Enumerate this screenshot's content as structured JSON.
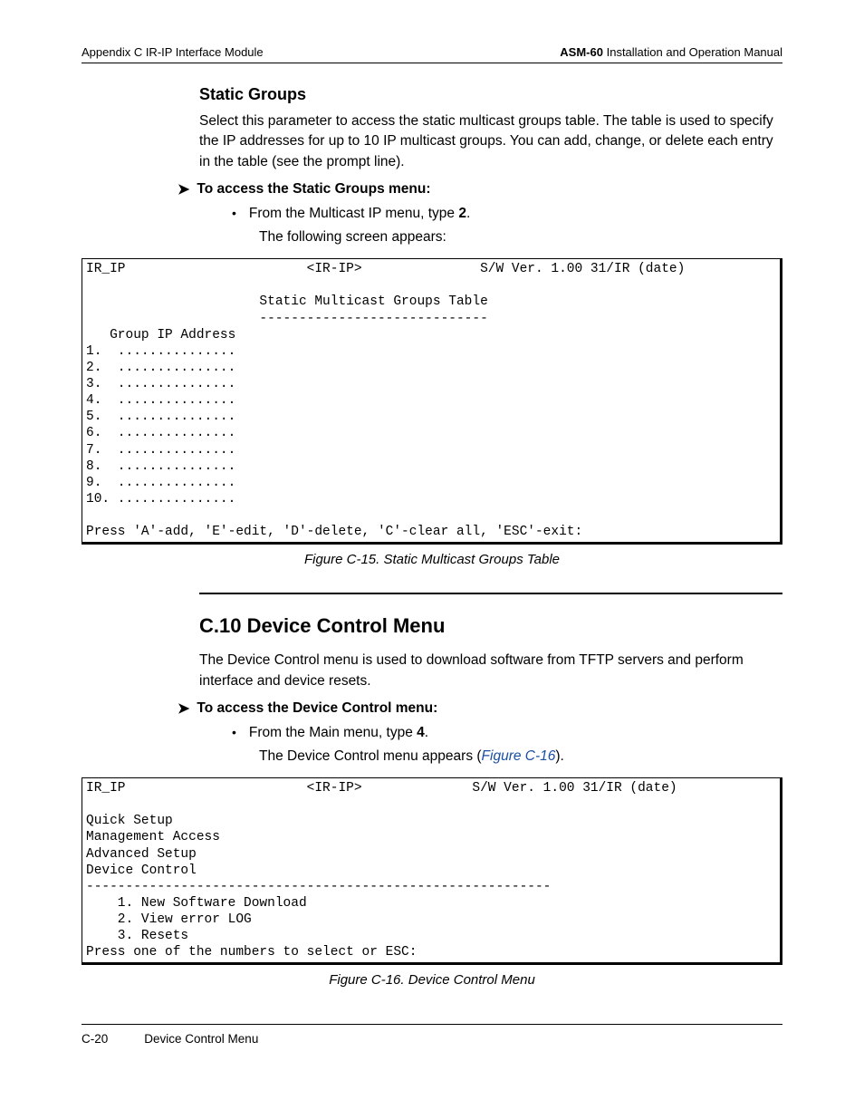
{
  "header": {
    "left": "Appendix C  IR-IP Interface Module",
    "right_bold": "ASM-60",
    "right_rest": " Installation and Operation Manual"
  },
  "sec1": {
    "title": "Static Groups",
    "para": "Select this parameter to access the static multicast groups table. The table is used to specify the IP addresses for up to 10 IP multicast groups. You can add, change, or delete each entry in the table (see the prompt line).",
    "proc": "To access the Static Groups menu:",
    "bullet_pre": "From the Multicast IP menu, type ",
    "bullet_bold": "2",
    "bullet_post": ".",
    "result": "The following screen appears:",
    "caption": "Figure C-15.  Static Multicast Groups Table"
  },
  "terminal1": "IR_IP                       <IR-IP>               S/W Ver. 1.00 31/IR (date)\n\n                      Static Multicast Groups Table\n                      -----------------------------\n   Group IP Address\n1.  ...............\n2.  ...............\n3.  ...............\n4.  ...............\n5.  ...............\n6.  ...............\n7.  ...............\n8.  ...............\n9.  ...............\n10. ...............\n\nPress 'A'-add, 'E'-edit, 'D'-delete, 'C'-clear all, 'ESC'-exit:",
  "sec2": {
    "heading": "C.10    Device Control Menu",
    "para": "The Device Control menu is used to download software from TFTP servers and perform interface and device resets.",
    "proc": "To access the Device Control menu:",
    "bullet_pre": "From the Main menu, type ",
    "bullet_bold": "4",
    "bullet_post": ".",
    "result_pre": "The Device Control menu appears (",
    "result_link": "Figure C-16",
    "result_post": ").",
    "caption": "Figure C-16.  Device Control Menu"
  },
  "terminal2": "IR_IP                       <IR-IP>              S/W Ver. 1.00 31/IR (date)\n\nQuick Setup\nManagement Access\nAdvanced Setup\nDevice Control\n-----------------------------------------------------------\n    1. New Software Download\n    2. View error LOG\n    3. Resets\nPress one of the numbers to select or ESC:",
  "footer": {
    "page": "C-20",
    "title": "Device Control Menu"
  }
}
